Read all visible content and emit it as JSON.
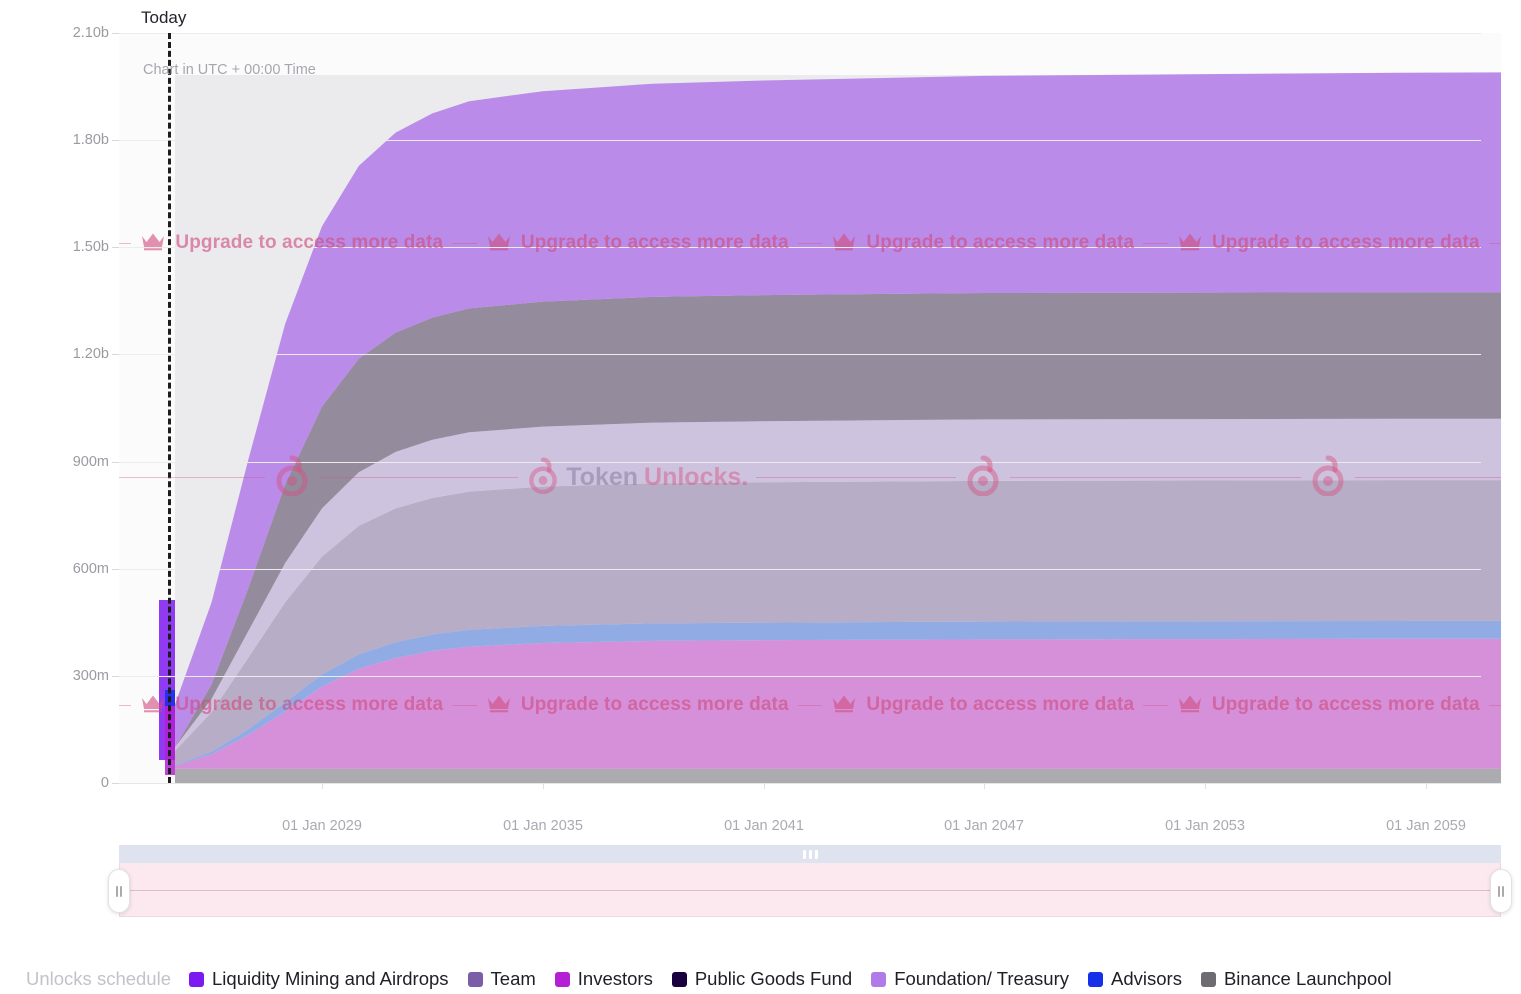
{
  "today_label": "Today",
  "utc_note": "Chart in UTC + 00:00 Time",
  "upgrade": {
    "text": "Upgrade to access more data",
    "icon": "crown-icon",
    "color": "#d04c7c"
  },
  "watermark": {
    "word_a": "Token",
    "word_b": "Unlocks.",
    "icon": "lock-icon",
    "color": "#d45080"
  },
  "legend": {
    "title": "Unlocks schedule",
    "items": [
      {
        "label": "Liquidity Mining and Airdrops",
        "color": "#7c18f0"
      },
      {
        "label": "Team",
        "color": "#7b5ea7"
      },
      {
        "label": "Investors",
        "color": "#b51fd4"
      },
      {
        "label": "Public Goods Fund",
        "color": "#1a0040"
      },
      {
        "label": "Foundation/ Treasury",
        "color": "#b07be8"
      },
      {
        "label": "Advisors",
        "color": "#1430e8"
      },
      {
        "label": "Binance Launchpool",
        "color": "#6e6b72"
      }
    ]
  },
  "brush": {
    "left_handle": "range-start-handle",
    "right_handle": "range-end-handle",
    "drag_bar": "range-drag-bar"
  },
  "chart_data": {
    "type": "area",
    "title": "",
    "xlabel": "",
    "ylabel": "",
    "stacked": true,
    "grid": true,
    "legend_position": "bottom",
    "ylim": [
      0,
      2100000000
    ],
    "ytick_labels": [
      "0",
      "300m",
      "600m",
      "900m",
      "1.20b",
      "1.50b",
      "1.80b",
      "2.10b"
    ],
    "ytick_values": [
      0,
      300000000,
      600000000,
      900000000,
      1200000000,
      1500000000,
      1800000000,
      2100000000
    ],
    "xtick_labels": [
      "01 Jan 2029",
      "01 Jan 2035",
      "01 Jan 2041",
      "01 Jan 2047",
      "01 Jan 2053",
      "01 Jan 2059"
    ],
    "xtick_years": [
      2029,
      2035,
      2041,
      2047,
      2053,
      2059
    ],
    "x_years": [
      2024,
      2025,
      2026,
      2027,
      2028,
      2029,
      2030,
      2031,
      2032,
      2033,
      2035,
      2038,
      2041,
      2047,
      2053,
      2059,
      2062
    ],
    "today_year": 2025,
    "max_supply": 2000000000,
    "series": [
      {
        "name": "Binance Launchpool",
        "color": "#a7a6ab",
        "values": [
          32000000,
          40000000,
          40000000,
          40000000,
          40000000,
          40000000,
          40000000,
          40000000,
          40000000,
          40000000,
          40000000,
          40000000,
          40000000,
          40000000,
          40000000,
          40000000,
          40000000
        ]
      },
      {
        "name": "Investors",
        "color": "#d489d8",
        "values": [
          0,
          8000000,
          40000000,
          95000000,
          160000000,
          230000000,
          280000000,
          310000000,
          330000000,
          342000000,
          352000000,
          358000000,
          360000000,
          362000000,
          363000000,
          364000000,
          364000000
        ]
      },
      {
        "name": "Advisors",
        "color": "#8aa7e3",
        "values": [
          0,
          2000000,
          8000000,
          16000000,
          26000000,
          34000000,
          40000000,
          44000000,
          46000000,
          47000000,
          48000000,
          49000000,
          49000000,
          50000000,
          50000000,
          50000000,
          50000000
        ]
      },
      {
        "name": "Foundation/ Treasury",
        "color": "#b3a8c4",
        "values": [
          18000000,
          40000000,
          110000000,
          200000000,
          280000000,
          330000000,
          360000000,
          375000000,
          382000000,
          387000000,
          390000000,
          392000000,
          393000000,
          394000000,
          394000000,
          394000000,
          394000000
        ]
      },
      {
        "name": "Public Goods Fund",
        "color": "#cbc0dd",
        "values": [
          4000000,
          10000000,
          38000000,
          75000000,
          110000000,
          135000000,
          150000000,
          158000000,
          163000000,
          166000000,
          168000000,
          170000000,
          171000000,
          172000000,
          172000000,
          172000000,
          172000000
        ]
      },
      {
        "name": "Team",
        "color": "#8d8397",
        "values": [
          0,
          0,
          40000000,
          120000000,
          220000000,
          285000000,
          318000000,
          334000000,
          342000000,
          347000000,
          350000000,
          352000000,
          353000000,
          354000000,
          354000000,
          354000000,
          354000000
        ]
      },
      {
        "name": "Liquidity Mining and Airdrops",
        "color": "#b683e8",
        "values": [
          58000000,
          120000000,
          230000000,
          360000000,
          450000000,
          505000000,
          540000000,
          560000000,
          572000000,
          580000000,
          589000000,
          597000000,
          601000000,
          608000000,
          612000000,
          615000000,
          616000000
        ]
      }
    ]
  }
}
